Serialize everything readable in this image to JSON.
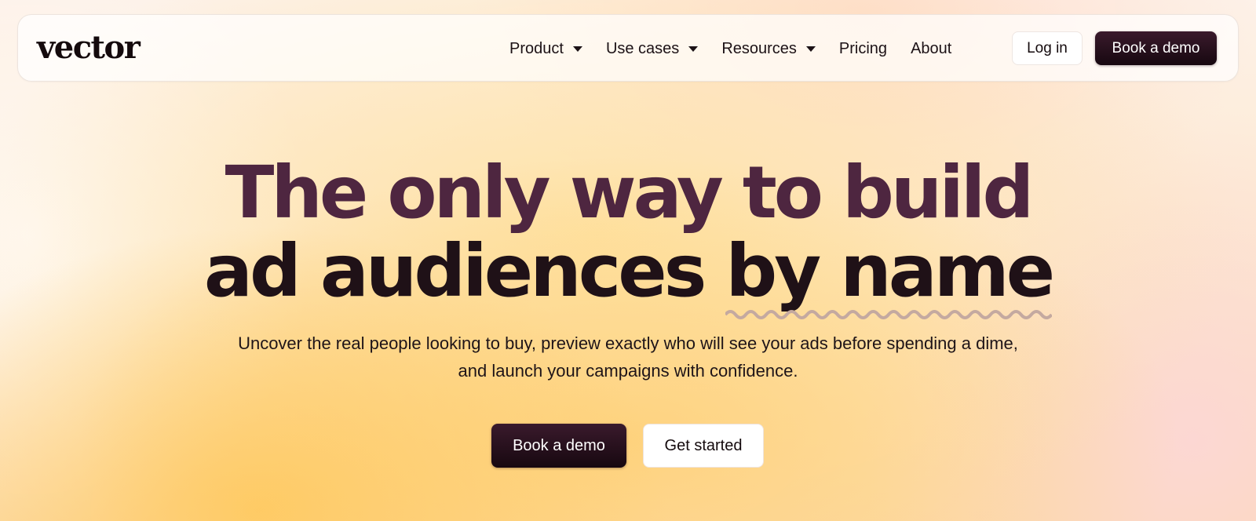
{
  "brand": {
    "logo_text": "vector"
  },
  "nav": {
    "items": [
      {
        "label": "Product",
        "has_dropdown": true
      },
      {
        "label": "Use cases",
        "has_dropdown": true
      },
      {
        "label": "Resources",
        "has_dropdown": true
      },
      {
        "label": "Pricing",
        "has_dropdown": false
      },
      {
        "label": "About",
        "has_dropdown": false
      }
    ],
    "login_label": "Log in",
    "demo_label": "Book a demo"
  },
  "hero": {
    "title_line1": "The only way to build",
    "title_line2_part1": "ad audiences ",
    "title_line2_highlight": "by name",
    "subtitle": "Uncover the real people looking to buy, preview exactly who will see your ads before spending a dime, and launch your campaigns with confidence.",
    "primary_cta": "Book a demo",
    "secondary_cta": "Get started"
  },
  "colors": {
    "accent_dark": "#1f1117",
    "title_plum": "#4e2640",
    "squiggle": "#c4a9a0"
  }
}
